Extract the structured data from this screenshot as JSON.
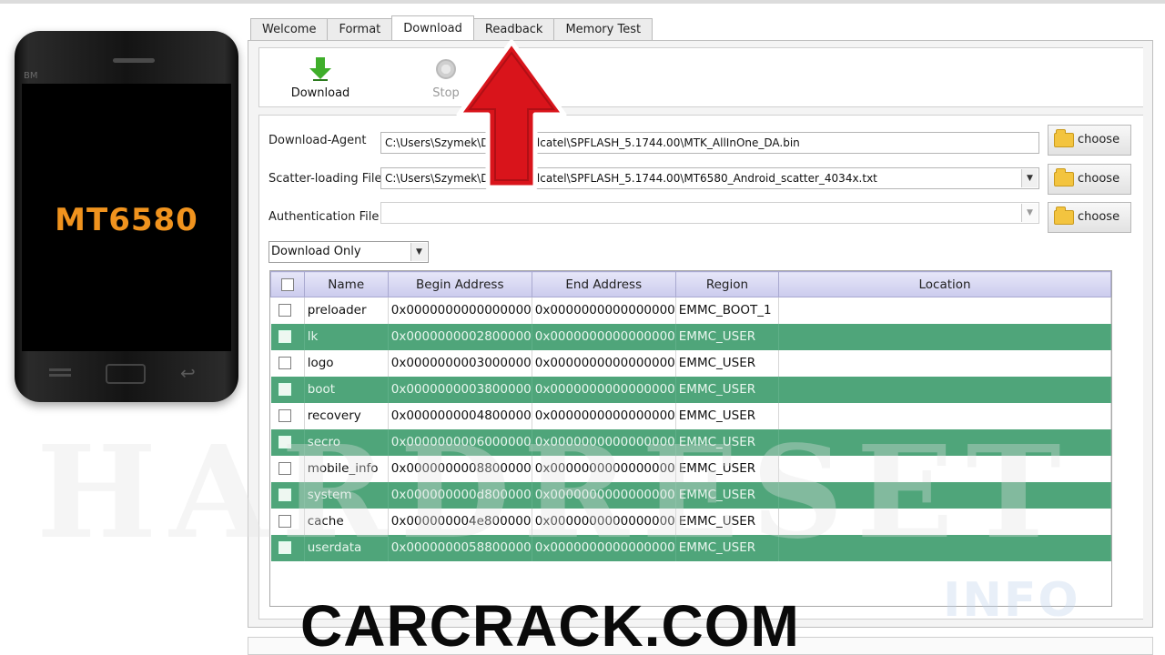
{
  "phone": {
    "brand": "BM",
    "model": "MT6580",
    "back_glyph": "↩"
  },
  "tabs": [
    {
      "label": "Welcome"
    },
    {
      "label": "Format"
    },
    {
      "label": "Download",
      "active": true
    },
    {
      "label": "Readback"
    },
    {
      "label": "Memory Test"
    }
  ],
  "toolbar": {
    "download_label": "Download",
    "stop_label": "Stop"
  },
  "form": {
    "agent_label": "Download-Agent",
    "agent_value": "C:\\Users\\Szymek\\Desktop\\Alcatel\\SPFLASH_5.1744.00\\MTK_AllInOne_DA.bin",
    "scatter_label": "Scatter-loading File",
    "scatter_value": "C:\\Users\\Szymek\\Desktop\\Alcatel\\SPFLASH_5.1744.00\\MT6580_Android_scatter_4034x.txt",
    "auth_label": "Authentication File",
    "auth_value": "",
    "choose_label": "choose",
    "mode_value": "Download Only"
  },
  "table": {
    "headers": [
      "Name",
      "Begin Address",
      "End Address",
      "Region",
      "Location"
    ],
    "rows": [
      {
        "name": "preloader",
        "begin": "0x0000000000000000",
        "end": "0x0000000000000000",
        "region": "EMMC_BOOT_1",
        "location": ""
      },
      {
        "name": "lk",
        "begin": "0x0000000002800000",
        "end": "0x0000000000000000",
        "region": "EMMC_USER",
        "location": ""
      },
      {
        "name": "logo",
        "begin": "0x0000000003000000",
        "end": "0x0000000000000000",
        "region": "EMMC_USER",
        "location": ""
      },
      {
        "name": "boot",
        "begin": "0x0000000003800000",
        "end": "0x0000000000000000",
        "region": "EMMC_USER",
        "location": ""
      },
      {
        "name": "recovery",
        "begin": "0x0000000004800000",
        "end": "0x0000000000000000",
        "region": "EMMC_USER",
        "location": ""
      },
      {
        "name": "secro",
        "begin": "0x0000000006000000",
        "end": "0x0000000000000000",
        "region": "EMMC_USER",
        "location": ""
      },
      {
        "name": "mobile_info",
        "begin": "0x0000000008800000",
        "end": "0x0000000000000000",
        "region": "EMMC_USER",
        "location": ""
      },
      {
        "name": "system",
        "begin": "0x000000000d800000",
        "end": "0x0000000000000000",
        "region": "EMMC_USER",
        "location": ""
      },
      {
        "name": "cache",
        "begin": "0x000000004e800000",
        "end": "0x0000000000000000",
        "region": "EMMC_USER",
        "location": ""
      },
      {
        "name": "userdata",
        "begin": "0x0000000058800000",
        "end": "0x0000000000000000",
        "region": "EMMC_USER",
        "location": ""
      }
    ]
  },
  "overlay": {
    "watermark": "HARDRESET",
    "watermark_suffix": "INFO",
    "caption": "CARCRACK.COM",
    "arrow_color": "#d9141b"
  }
}
